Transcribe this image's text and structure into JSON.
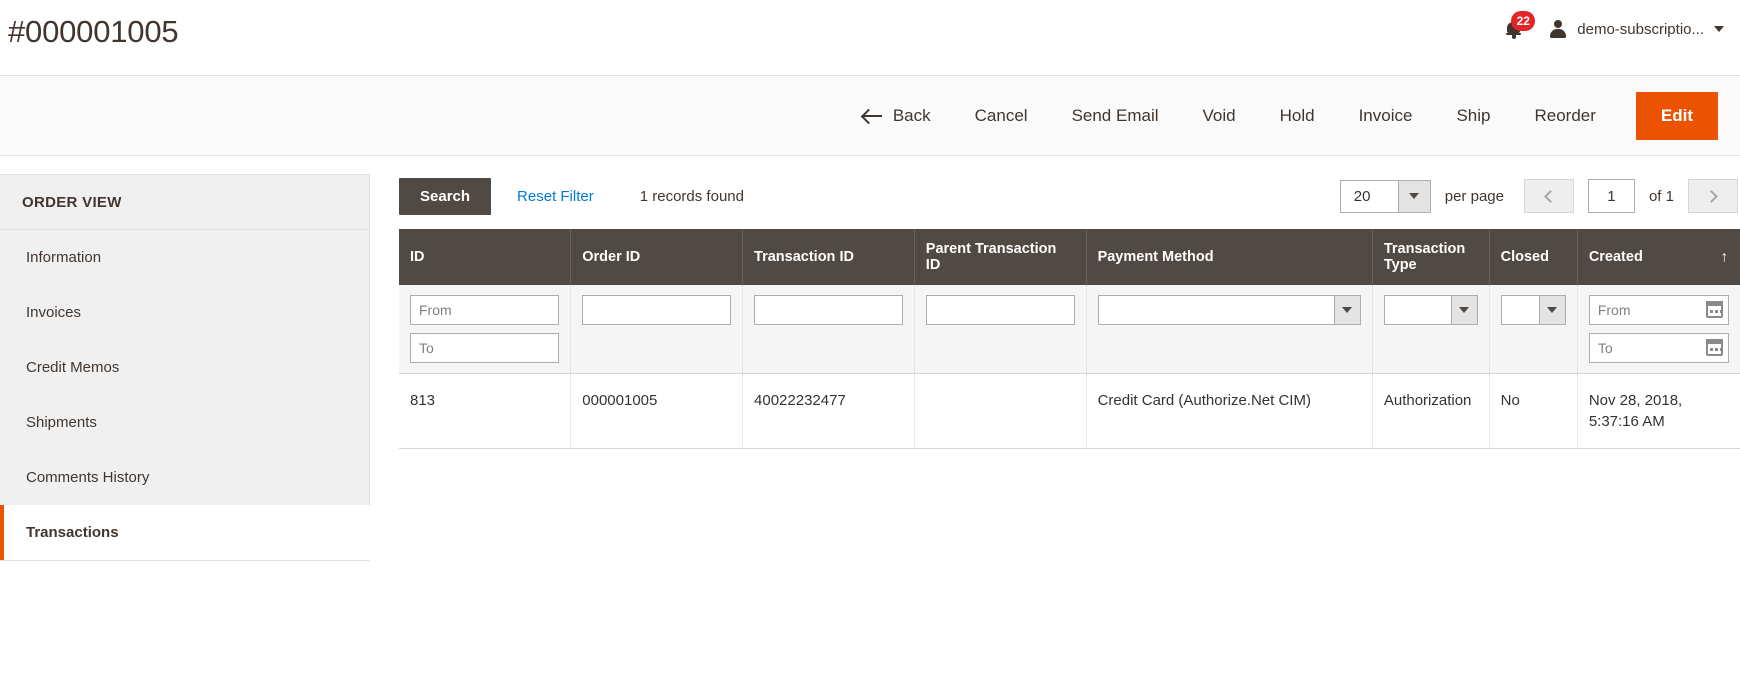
{
  "header": {
    "title": "#000001005",
    "notifications_count": "22",
    "user_name": "demo-subscriptio...",
    "bell_icon": "bell-icon",
    "avatar_icon": "user-avatar-icon",
    "caret_icon": "chevron-down-icon"
  },
  "actions": {
    "back": "Back",
    "back_icon": "arrow-left-icon",
    "cancel": "Cancel",
    "send_email": "Send Email",
    "void": "Void",
    "hold": "Hold",
    "invoice": "Invoice",
    "ship": "Ship",
    "reorder": "Reorder",
    "edit": "Edit",
    "edit_color": "#eb5202"
  },
  "sidebar": {
    "title": "ORDER VIEW",
    "items": [
      {
        "label": "Information",
        "active": false
      },
      {
        "label": "Invoices",
        "active": false
      },
      {
        "label": "Credit Memos",
        "active": false
      },
      {
        "label": "Shipments",
        "active": false
      },
      {
        "label": "Comments History",
        "active": false
      },
      {
        "label": "Transactions",
        "active": true
      }
    ],
    "active_accent": "#eb5202"
  },
  "toolbar": {
    "search_label": "Search",
    "reset_filter_label": "Reset Filter",
    "records_found": "1 records found",
    "per_page_value": "20",
    "per_page_label": "per page",
    "prev_icon": "chevron-left-icon",
    "next_icon": "chevron-right-icon",
    "page_value": "1",
    "of_label": "of 1"
  },
  "grid": {
    "columns": [
      {
        "label": "ID",
        "sorted": false
      },
      {
        "label": "Order ID",
        "sorted": false
      },
      {
        "label": "Transaction ID",
        "sorted": false
      },
      {
        "label": "Parent Transaction ID",
        "sorted": false
      },
      {
        "label": "Payment Method",
        "sorted": false
      },
      {
        "label": "Transaction Type",
        "sorted": false
      },
      {
        "label": "Closed",
        "sorted": false
      },
      {
        "label": "Created",
        "sorted": true,
        "sort_indicator": "↑"
      }
    ],
    "filters": {
      "id_from_placeholder": "From",
      "id_to_placeholder": "To",
      "order_id": "",
      "transaction_id": "",
      "parent_transaction_id": "",
      "payment_method": "",
      "transaction_type": "",
      "closed": "",
      "created_from_placeholder": "From",
      "created_to_placeholder": "To",
      "calendar_icon": "calendar-icon"
    },
    "rows": [
      {
        "id": "813",
        "order_id": "000001005",
        "transaction_id": "40022232477",
        "parent_transaction_id": "",
        "payment_method": "Credit Card (Authorize.Net CIM)",
        "transaction_type": "Authorization",
        "closed": "No",
        "created": "Nov 28, 2018, 5:37:16 AM"
      }
    ]
  }
}
